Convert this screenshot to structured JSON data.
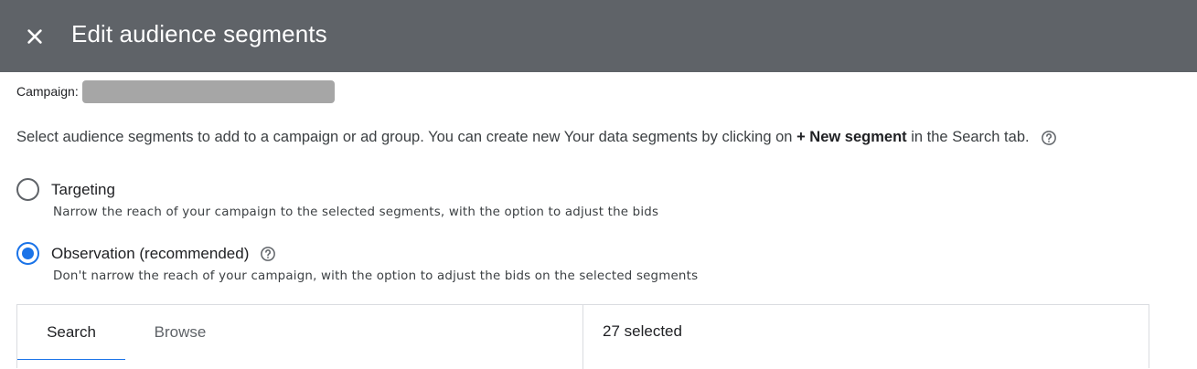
{
  "header": {
    "title": "Edit audience segments",
    "close_icon": "close-icon"
  },
  "campaign": {
    "label": "Campaign:",
    "value": ""
  },
  "intro": {
    "text_before": "Select audience segments to add to a campaign or ad group. You can create new Your data segments by clicking on ",
    "bold": "+ New segment",
    "text_after": " in the Search tab.",
    "help_icon": "help-icon"
  },
  "options": [
    {
      "label": "Targeting",
      "description": "Narrow the reach of your campaign to the selected segments, with the option to adjust the bids",
      "checked": false
    },
    {
      "label": "Observation (recommended)",
      "description": "Don't narrow the reach of your campaign, with the option to adjust the bids on the selected segments",
      "checked": true
    }
  ],
  "tabs": [
    {
      "label": "Search",
      "active": true
    },
    {
      "label": "Browse",
      "active": false
    }
  ],
  "selection": {
    "count_text": "27 selected"
  },
  "colors": {
    "header_bg": "#5f6368",
    "accent": "#1a73e8",
    "redacted": "#a6a6a6"
  }
}
